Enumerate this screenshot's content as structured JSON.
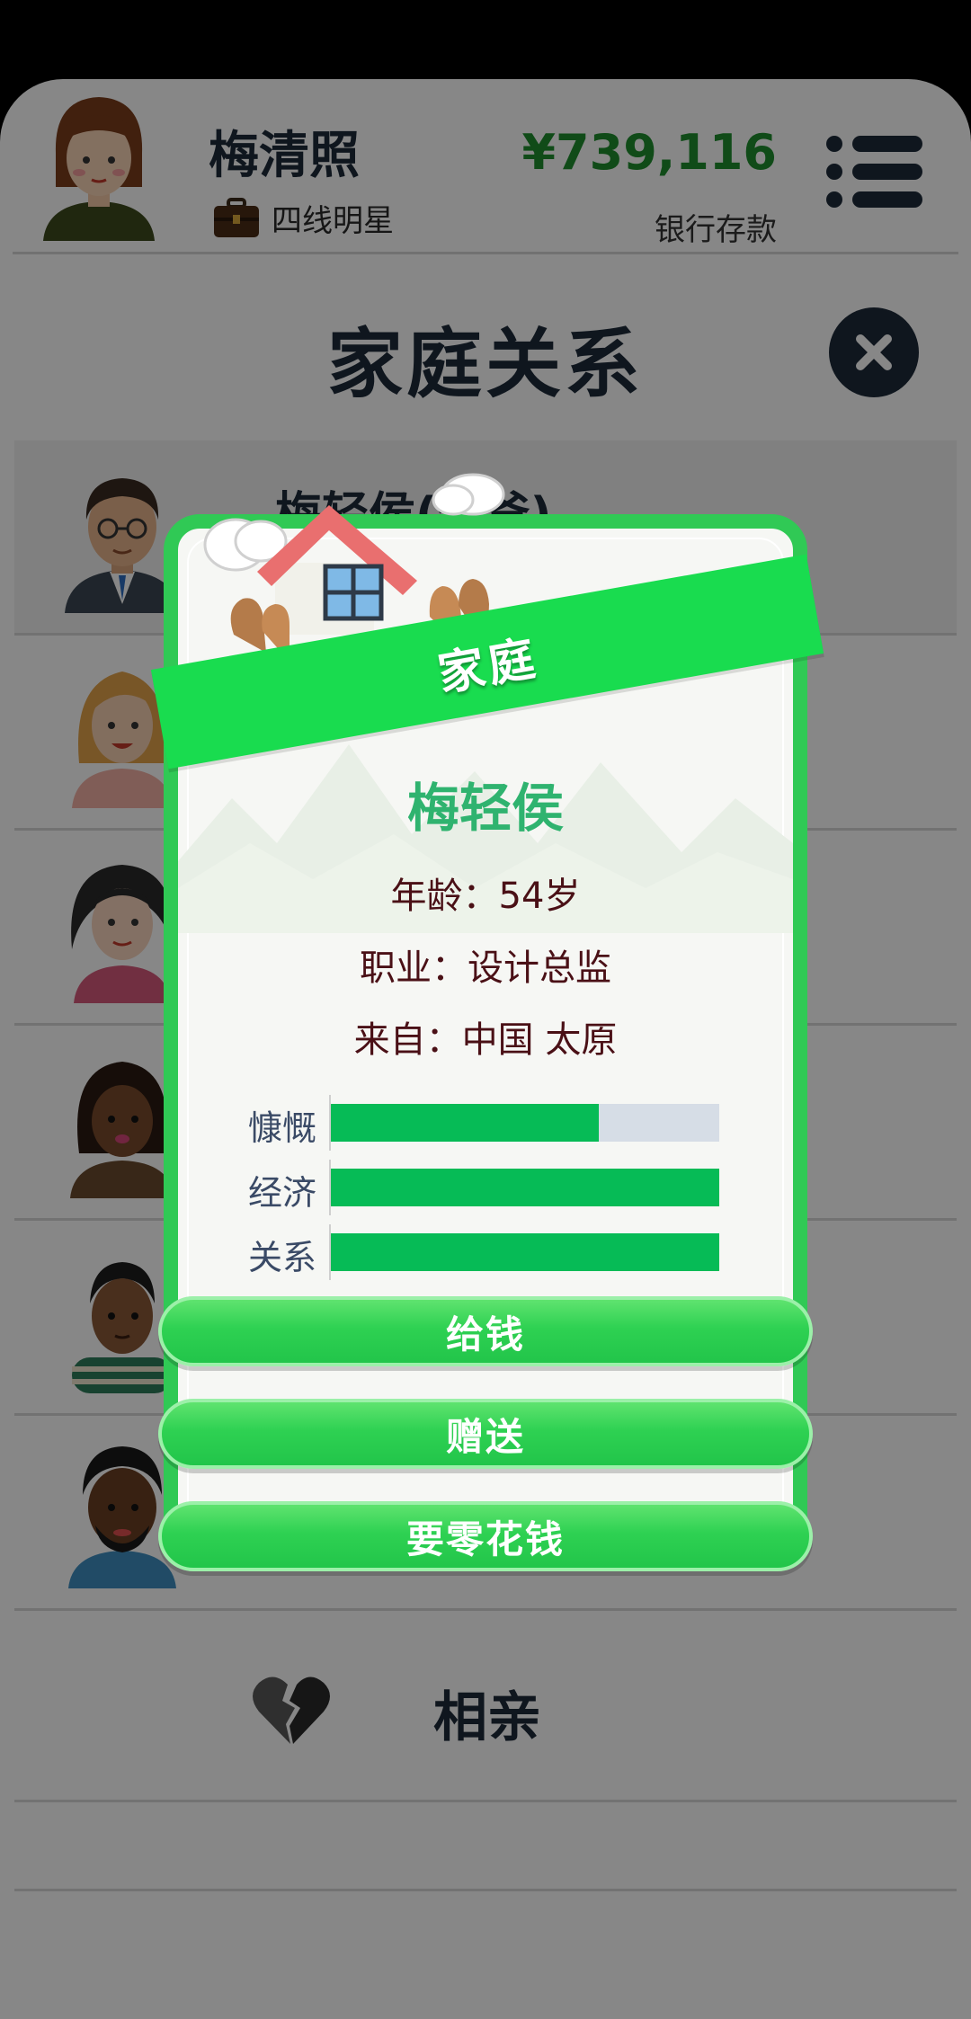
{
  "header": {
    "player_name": "梅清照",
    "job_title": "四线明星",
    "money": "¥739,116",
    "money_label": "银行存款"
  },
  "page": {
    "title": "家庭关系"
  },
  "family_list": [
    {
      "name": "梅轻侯(爸爸)"
    },
    {
      "name": ""
    },
    {
      "name": ""
    },
    {
      "name": ""
    },
    {
      "name": ""
    },
    {
      "name": ""
    }
  ],
  "dating": {
    "label": "相亲"
  },
  "modal": {
    "banner": "家庭",
    "name": "梅轻侯",
    "age": "年龄：54岁",
    "job": "职业：设计总监",
    "origin": "来自：中国 太原",
    "stats": [
      {
        "label": "慷慨",
        "value": 0.69
      },
      {
        "label": "经济",
        "value": 1.0
      },
      {
        "label": "关系",
        "value": 1.0
      }
    ],
    "buttons": {
      "give_money": "给钱",
      "gift": "赠送",
      "ask_allowance": "要零花钱"
    }
  },
  "colors": {
    "accent_green": "#30c955",
    "bar_fill": "#06bb56",
    "name_green": "#2fb36f",
    "money_green": "#1f8f2e",
    "dark_navy": "#1e2b3a"
  }
}
